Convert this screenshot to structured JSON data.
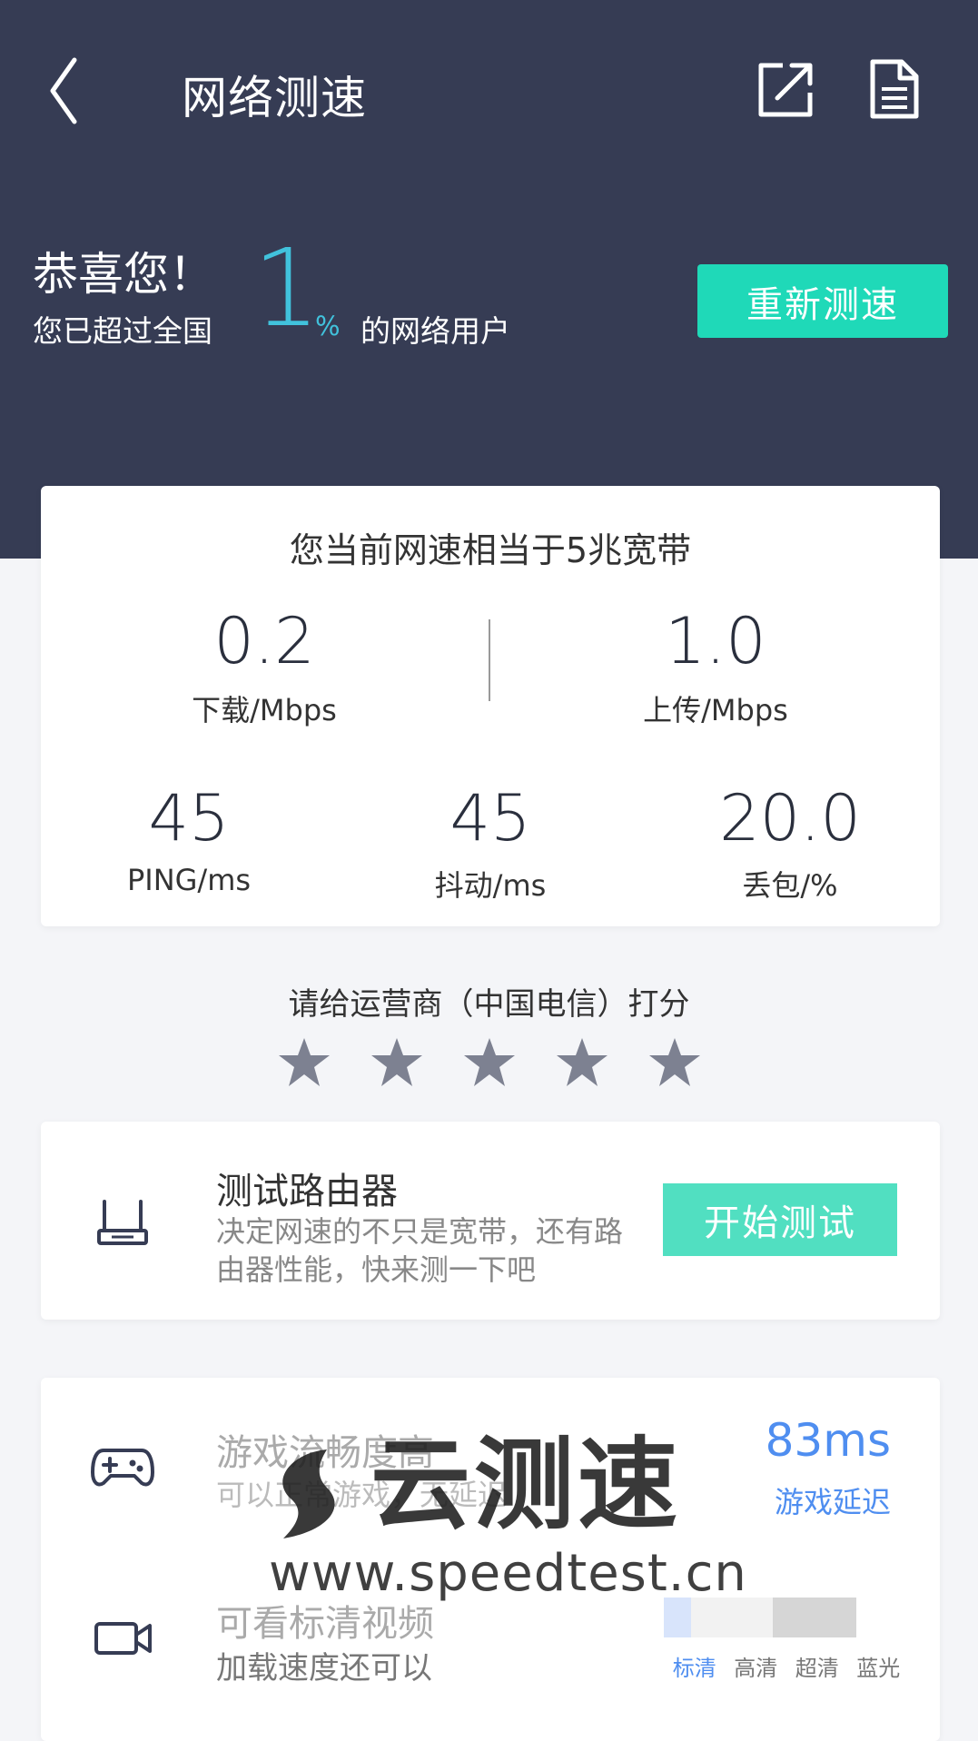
{
  "header": {
    "title": "网络测速"
  },
  "rank": {
    "congrats": "恭喜您！",
    "prefix": "您已超过全国",
    "value": "1",
    "unit": "%",
    "suffix": "的网络用户",
    "retest_label": "重新测速"
  },
  "speed": {
    "equivalent": "您当前网速相当于5兆宽带",
    "download_value": "0.2",
    "download_label": "下载/Mbps",
    "upload_value": "1.0",
    "upload_label": "上传/Mbps",
    "ping_value": "45",
    "ping_label": "PING/ms",
    "jitter_value": "45",
    "jitter_label": "抖动/ms",
    "loss_value": "20.0",
    "loss_label": "丢包/%"
  },
  "rating": {
    "title": "请给运营商（中国电信）打分",
    "stars": 5,
    "star_color": "#7d8191"
  },
  "router": {
    "title": "测试路由器",
    "desc": "决定网速的不只是宽带，还有路由器性能，快来测一下吧",
    "button": "开始测试"
  },
  "game": {
    "title": "游戏流畅度高",
    "desc": "可以正常游戏，无延迟",
    "latency_value": "83ms",
    "latency_label": "游戏延迟"
  },
  "video": {
    "title": "可看标清视频",
    "desc": "加载速度还可以",
    "qualities": [
      "标清",
      "高清",
      "超清",
      "蓝光"
    ],
    "current_quality": "标清"
  },
  "watermark": {
    "brand": "云测速",
    "url": "www.speedtest.cn"
  },
  "colors": {
    "header_bg": "#363c54",
    "accent_teal": "#1fd9b8",
    "rank_blue": "#41c2dc",
    "latency_blue": "#4f8ef0"
  }
}
